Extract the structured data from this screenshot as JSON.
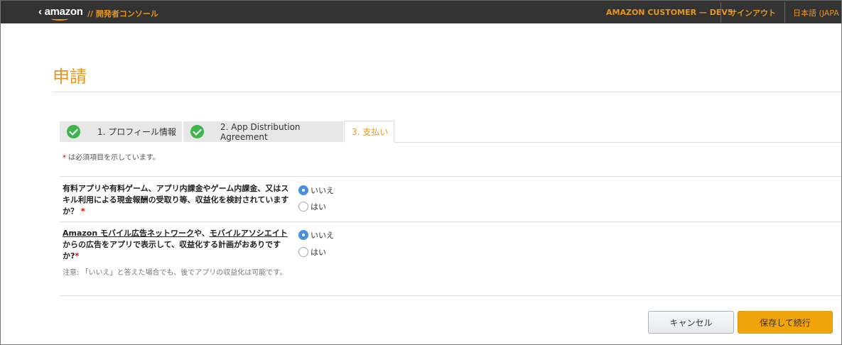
{
  "header": {
    "logo": "amazon",
    "back_icon": "chevron-left-icon",
    "console": "// 開発者コンソール",
    "user": "AMAZON CUSTOMER — DEV5",
    "signout": "サインアウト",
    "language": "日本語 (JAPA"
  },
  "page_title": "申請",
  "tabs": [
    {
      "label": "1. プロフィール情報",
      "completed": true
    },
    {
      "label": "2. App Distribution Agreement",
      "completed": true
    },
    {
      "label": "3. 支払い",
      "active": true
    }
  ],
  "required_note": {
    "star": "*",
    "text": " は必須項目を示しています。"
  },
  "questions": [
    {
      "text": "有料アプリや有料ゲーム、アプリ内課金やゲーム内課金、又はスキル利用による現金報酬の受取り等、収益化を検討されていますか？",
      "star": "*",
      "options": [
        "いいえ",
        "はい"
      ],
      "selected": "いいえ"
    },
    {
      "link1": "Amazon モバイル広告ネットワーク",
      "mid": "や、",
      "link2": "モバイルアソシエイト",
      "text": "からの広告をアプリで表示して、収益化する計画がおありですか?",
      "star": "*",
      "options": [
        "いいえ",
        "はい"
      ],
      "selected": "いいえ",
      "note": "注意: 「いいえ」と答えた場合でも、後でアプリの収益化は可能です。"
    }
  ],
  "buttons": {
    "cancel": "キャンセル",
    "save": "保存して続行"
  },
  "colors": {
    "accent": "#e8961b",
    "header_bg": "#333333",
    "save_bg": "#f0a30a",
    "check": "#3cb54a",
    "radio": "#4a90e2"
  }
}
